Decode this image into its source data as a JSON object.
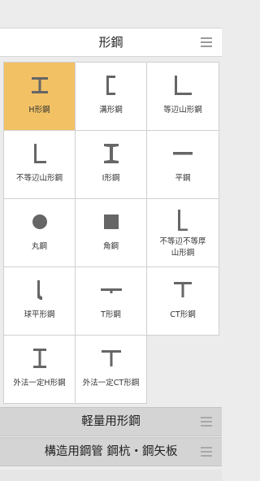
{
  "header": {
    "title": "形鋼"
  },
  "grid_items": [
    {
      "label": "H形鋼",
      "icon": "h-beam-icon"
    },
    {
      "label": "溝形鋼",
      "icon": "channel-icon"
    },
    {
      "label": "等辺山形鋼",
      "icon": "equal-angle-icon"
    },
    {
      "label": "不等辺山形鋼",
      "icon": "unequal-angle-icon"
    },
    {
      "label": "I形鋼",
      "icon": "i-beam-icon"
    },
    {
      "label": "平鋼",
      "icon": "flat-bar-icon"
    },
    {
      "label": "丸鋼",
      "icon": "round-bar-icon"
    },
    {
      "label": "角鋼",
      "icon": "square-bar-icon"
    },
    {
      "label": "不等辺不等厚\n山形鋼",
      "icon": "unequal-thickness-angle-icon"
    },
    {
      "label": "球平形鋼",
      "icon": "bulb-flat-icon"
    },
    {
      "label": "T形鋼",
      "icon": "t-bar-icon"
    },
    {
      "label": "CT形鋼",
      "icon": "ct-section-icon"
    },
    {
      "label": "外法一定H形鋼",
      "icon": "fixed-outer-h-beam-icon"
    },
    {
      "label": "外法一定CT形鋼",
      "icon": "fixed-outer-ct-icon"
    }
  ],
  "sections": [
    {
      "title": "軽量用形鋼"
    },
    {
      "title": "構造用鋼管 鋼杭・鋼矢板"
    }
  ],
  "colors": {
    "selected": "#f2c164",
    "icon": "#666666"
  }
}
